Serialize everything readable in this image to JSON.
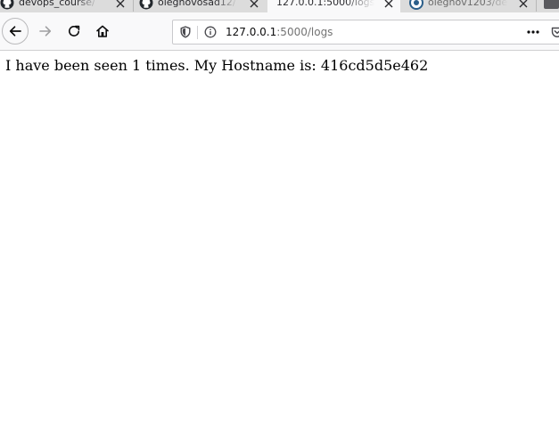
{
  "browser": {
    "tabs": [
      {
        "title": "devops_course/",
        "icon": "github-icon",
        "active": false
      },
      {
        "title": "olegnovosad12/",
        "icon": "github-icon",
        "active": false
      },
      {
        "title": "127.0.0.1:5000/logs",
        "icon": "",
        "active": true
      },
      {
        "title": "olegnov1203/de",
        "icon": "docker-icon",
        "active": false
      }
    ],
    "nav": {
      "back_icon": "arrow-left-icon",
      "forward_icon": "arrow-right-icon",
      "reload_icon": "reload-icon",
      "home_icon": "home-icon"
    },
    "urlbar": {
      "host": "127.0.0.1",
      "path": ":5000/logs",
      "shield_icon": "shield-icon",
      "info_icon": "info-icon",
      "page_actions_icon": "more-horizontal-icon",
      "pocket_icon": "pocket-icon"
    }
  },
  "page": {
    "text": "I have been seen 1 times. My Hostname is: 416cd5d5e462"
  },
  "colors": {
    "tabstrip_bg": "#dcdcdc",
    "toolbar_bg": "#f9f9fa",
    "url_path": "#737373"
  }
}
